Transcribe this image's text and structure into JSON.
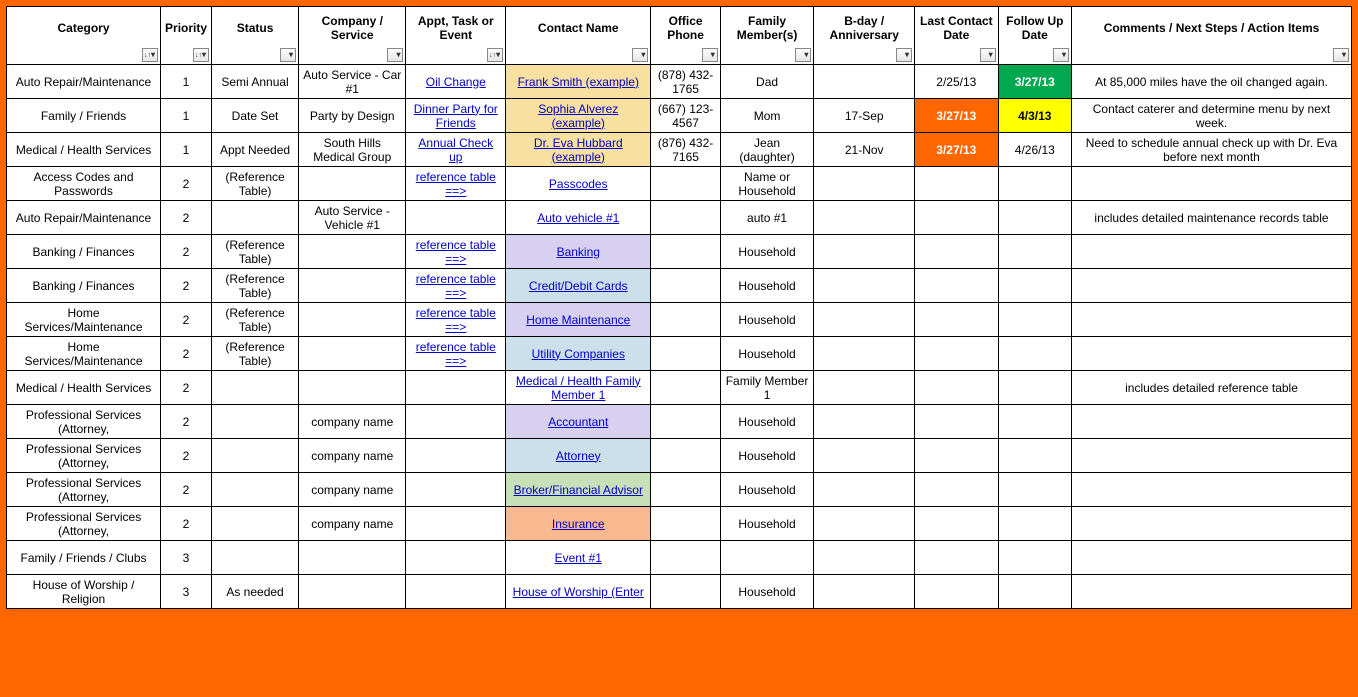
{
  "columns": [
    {
      "label": "Category",
      "sort": true
    },
    {
      "label": "Priority",
      "sort": true
    },
    {
      "label": "Status",
      "sort": false
    },
    {
      "label": "Company / Service",
      "sort": false
    },
    {
      "label": "Appt, Task or Event",
      "sort": true
    },
    {
      "label": "Contact Name",
      "sort": false
    },
    {
      "label": "Office Phone",
      "sort": false
    },
    {
      "label": "Family Member(s)",
      "sort": false
    },
    {
      "label": "B-day / Anniversary",
      "sort": false
    },
    {
      "label": "Last Contact Date",
      "sort": false
    },
    {
      "label": "Follow Up Date",
      "sort": false
    },
    {
      "label": "Comments / Next Steps / Action Items",
      "sort": false
    }
  ],
  "rows": [
    {
      "category": "Auto Repair/Maintenance",
      "priority": "1",
      "status": "Semi Annual",
      "company": "Auto Service - Car #1",
      "task": "Oil Change",
      "taskLink": true,
      "contact": "Frank Smith (example)",
      "contactBg": "bg-tan",
      "phone": "(878) 432-1765",
      "family": "Dad",
      "bday": "",
      "last": "2/25/13",
      "lastBg": "",
      "follow": "3/27/13",
      "followBg": "bg-green",
      "comments": "At 85,000 miles have the oil changed again."
    },
    {
      "category": "Family / Friends",
      "priority": "1",
      "status": "Date Set",
      "company": "Party by Design",
      "task": "Dinner Party for Friends",
      "taskLink": true,
      "contact": "Sophia Alverez (example)",
      "contactBg": "bg-tan",
      "phone": "(667) 123-4567",
      "family": "Mom",
      "bday": "17-Sep",
      "last": "3/27/13",
      "lastBg": "bg-orange",
      "follow": "4/3/13",
      "followBg": "bg-yellow",
      "comments": "Contact caterer and determine menu by next week."
    },
    {
      "category": "Medical / Health Services",
      "priority": "1",
      "status": "Appt Needed",
      "company": "South Hills Medical Group",
      "task": "Annual Check up",
      "taskLink": true,
      "contact": "Dr. Eva Hubbard (example)",
      "contactBg": "bg-tan",
      "phone": "(876) 432-7165",
      "family": "Jean (daughter)",
      "bday": "21-Nov",
      "last": "3/27/13",
      "lastBg": "bg-orange",
      "follow": "4/26/13",
      "followBg": "",
      "comments": "Need to schedule annual check up with Dr. Eva before next month"
    },
    {
      "category": "Access Codes and Passwords",
      "priority": "2",
      "status": "(Reference Table)",
      "company": "",
      "task": "reference table ==>",
      "taskLink": true,
      "contact": "Passcodes ",
      "contactBg": "",
      "phone": "",
      "family": "Name or Household",
      "bday": "",
      "last": "",
      "lastBg": "",
      "follow": "",
      "followBg": "",
      "comments": ""
    },
    {
      "category": "Auto Repair/Maintenance",
      "priority": "2",
      "status": "",
      "company": "Auto Service - Vehicle #1",
      "task": "",
      "taskLink": false,
      "contact": "Auto vehicle #1",
      "contactBg": "",
      "phone": "",
      "family": "auto #1",
      "bday": "",
      "last": "",
      "lastBg": "",
      "follow": "",
      "followBg": "",
      "comments": "includes detailed maintenance records table"
    },
    {
      "category": "Banking / Finances",
      "priority": "2",
      "status": "(Reference Table)",
      "company": "",
      "task": "reference table ==>",
      "taskLink": true,
      "contact": "Banking ",
      "contactBg": "bg-lav",
      "phone": "",
      "family": "Household",
      "bday": "",
      "last": "",
      "lastBg": "",
      "follow": "",
      "followBg": "",
      "comments": ""
    },
    {
      "category": "Banking / Finances",
      "priority": "2",
      "status": "(Reference Table)",
      "company": "",
      "task": "reference table ==>",
      "taskLink": true,
      "contact": "Credit/Debit Cards ",
      "contactBg": "bg-lblue",
      "phone": "",
      "family": "Household",
      "bday": "",
      "last": "",
      "lastBg": "",
      "follow": "",
      "followBg": "",
      "comments": ""
    },
    {
      "category": "Home Services/Maintenance",
      "priority": "2",
      "status": "(Reference Table)",
      "company": "",
      "task": "reference table ==>",
      "taskLink": true,
      "contact": "Home Maintenance ",
      "contactBg": "bg-lav",
      "phone": "",
      "family": "Household",
      "bday": "",
      "last": "",
      "lastBg": "",
      "follow": "",
      "followBg": "",
      "comments": ""
    },
    {
      "category": "Home Services/Maintenance",
      "priority": "2",
      "status": "(Reference Table)",
      "company": "",
      "task": "reference table ==>",
      "taskLink": true,
      "contact": "Utility Companies ",
      "contactBg": "bg-lblue",
      "phone": "",
      "family": "Household",
      "bday": "",
      "last": "",
      "lastBg": "",
      "follow": "",
      "followBg": "",
      "comments": ""
    },
    {
      "category": "Medical / Health Services",
      "priority": "2",
      "status": "",
      "company": "",
      "task": "",
      "taskLink": false,
      "contact": "Medical / Health Family Member 1",
      "contactBg": "",
      "phone": "",
      "family": "Family Member 1",
      "bday": "",
      "last": "",
      "lastBg": "",
      "follow": "",
      "followBg": "",
      "comments": "includes detailed reference table"
    },
    {
      "category": "Professional Services (Attorney,",
      "priority": "2",
      "status": "",
      "company": "company name",
      "task": "",
      "taskLink": false,
      "contact": "Accountant ",
      "contactBg": "bg-lav",
      "phone": "",
      "family": "Household",
      "bday": "",
      "last": "",
      "lastBg": "",
      "follow": "",
      "followBg": "",
      "comments": ""
    },
    {
      "category": "Professional Services (Attorney,",
      "priority": "2",
      "status": "",
      "company": "company name",
      "task": "",
      "taskLink": false,
      "contact": "Attorney ",
      "contactBg": "bg-lblue",
      "phone": "",
      "family": "Household",
      "bday": "",
      "last": "",
      "lastBg": "",
      "follow": "",
      "followBg": "",
      "comments": ""
    },
    {
      "category": "Professional Services (Attorney,",
      "priority": "2",
      "status": "",
      "company": "company name",
      "task": "",
      "taskLink": false,
      "contact": "Broker/Financial Advisor ",
      "contactBg": "bg-lgrn",
      "phone": "",
      "family": "Household",
      "bday": "",
      "last": "",
      "lastBg": "",
      "follow": "",
      "followBg": "",
      "comments": ""
    },
    {
      "category": "Professional Services (Attorney,",
      "priority": "2",
      "status": "",
      "company": "company name",
      "task": "",
      "taskLink": false,
      "contact": "Insurance ",
      "contactBg": "bg-coral",
      "phone": "",
      "family": "Household",
      "bday": "",
      "last": "",
      "lastBg": "",
      "follow": "",
      "followBg": "",
      "comments": ""
    },
    {
      "category": "Family / Friends / Clubs",
      "priority": "3",
      "status": "",
      "company": "",
      "task": "",
      "taskLink": false,
      "contact": "Event #1",
      "contactBg": "",
      "phone": "",
      "family": "",
      "bday": "",
      "last": "",
      "lastBg": "",
      "follow": "",
      "followBg": "",
      "comments": ""
    },
    {
      "category": "House of Worship / Religion",
      "priority": "3",
      "status": "As needed",
      "company": "",
      "task": "",
      "taskLink": false,
      "contact": "House of Worship (Enter ",
      "contactBg": "",
      "phone": "",
      "family": "Household",
      "bday": "",
      "last": "",
      "lastBg": "",
      "follow": "",
      "followBg": "",
      "comments": ""
    }
  ]
}
